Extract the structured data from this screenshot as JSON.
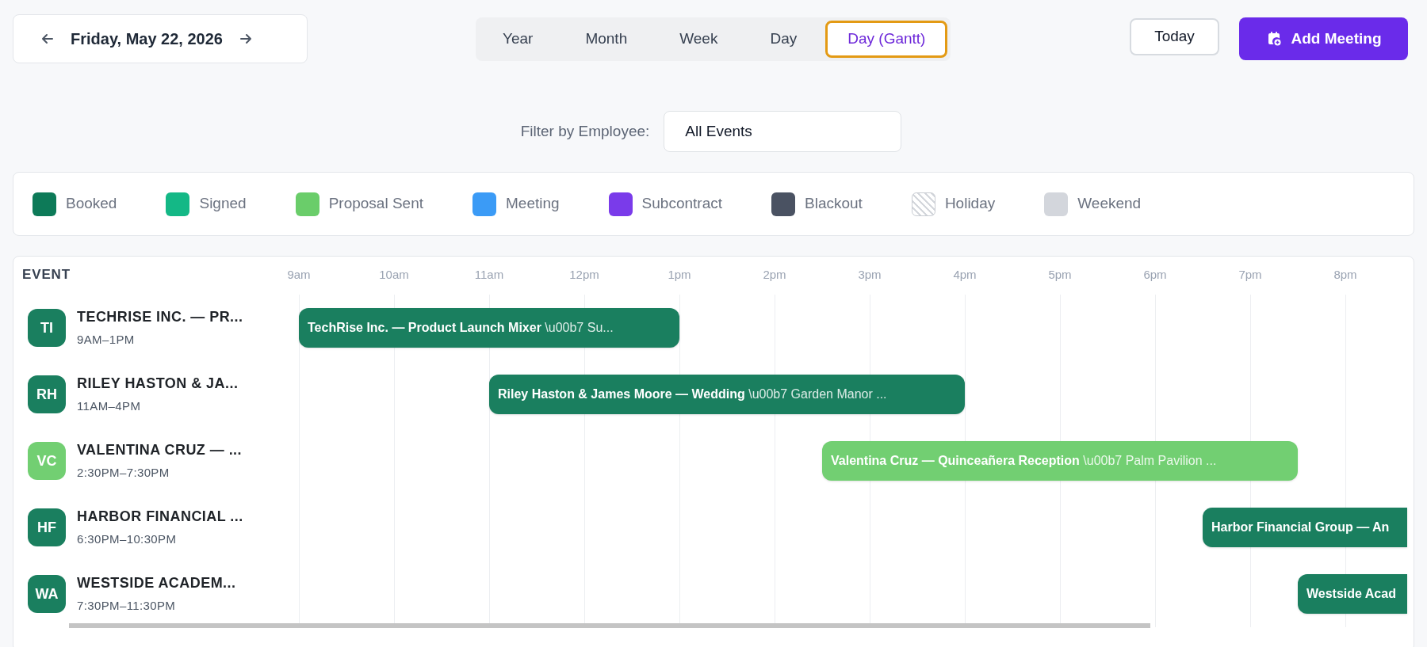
{
  "date_nav": {
    "label": "Friday, May 22, 2026"
  },
  "view_tabs": [
    {
      "label": "Year",
      "selected": false
    },
    {
      "label": "Month",
      "selected": false
    },
    {
      "label": "Week",
      "selected": false
    },
    {
      "label": "Day",
      "selected": false
    },
    {
      "label": "Day (Gantt)",
      "selected": true
    }
  ],
  "today_button": "Today",
  "add_button": "Add Meeting",
  "filter": {
    "label": "Filter by Employee:",
    "value": "All Events"
  },
  "legend": [
    {
      "label": "Booked",
      "color": "#0d7a58",
      "kind": "solid"
    },
    {
      "label": "Signed",
      "color": "#14b886",
      "kind": "solid"
    },
    {
      "label": "Proposal Sent",
      "color": "#6acd6a",
      "kind": "solid"
    },
    {
      "label": "Meeting",
      "color": "#3b9bf6",
      "kind": "solid"
    },
    {
      "label": "Subcontract",
      "color": "#7a3bea",
      "kind": "solid"
    },
    {
      "label": "Blackout",
      "color": "#4a5262",
      "kind": "solid"
    },
    {
      "label": "Holiday",
      "color": "#d4d7dc",
      "kind": "hatched"
    },
    {
      "label": "Weekend",
      "color": "#d3d6dc",
      "kind": "solid"
    }
  ],
  "gantt": {
    "column_header": "EVENT",
    "hours": [
      "9am",
      "10am",
      "11am",
      "12pm",
      "1pm",
      "2pm",
      "3pm",
      "4pm",
      "5pm",
      "6pm",
      "7pm",
      "8pm"
    ],
    "rows": [
      {
        "initials": "TI",
        "title": "TECHRISE INC. — PR...",
        "time": "9AM–1PM",
        "color": "#1a7f5f",
        "bar": "**TechRise Inc. — Product Launch Mixer** \\u00b7 Su..."
      },
      {
        "initials": "RH",
        "title": "RILEY HASTON & JA...",
        "time": "11AM–4PM",
        "color": "#1a7f5f",
        "bar": "**Riley Haston & James Moore — Wedding** \\u00b7 Garden Manor ..."
      },
      {
        "initials": "VC",
        "title": "VALENTINA CRUZ — ...",
        "time": "2:30PM–7:30PM",
        "color": "#72cf72",
        "bar": "**Valentina Cruz — Quinceañera Reception** \\u00b7 Palm Pavilion ..."
      },
      {
        "initials": "HF",
        "title": "HARBOR FINANCIAL ...",
        "time": "6:30PM–10:30PM",
        "color": "#1a7f5f",
        "bar": "**Harbor Financial Group — An**"
      },
      {
        "initials": "WA",
        "title": "WESTSIDE ACADEM...",
        "time": "7:30PM–11:30PM",
        "color": "#1a7f5f",
        "bar": "**Westside Acad**"
      }
    ]
  }
}
